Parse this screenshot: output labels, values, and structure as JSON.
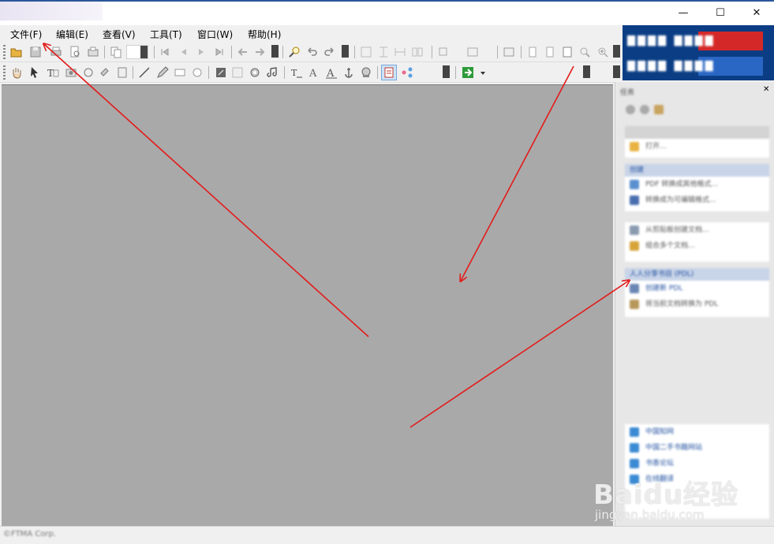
{
  "window": {
    "buttons": {
      "minimize": "—",
      "maximize": "☐",
      "close": "✕"
    }
  },
  "menubar": {
    "items": [
      {
        "label": "文件(F)"
      },
      {
        "label": "编辑(E)"
      },
      {
        "label": "查看(V)"
      },
      {
        "label": "工具(T)"
      },
      {
        "label": "窗口(W)"
      },
      {
        "label": "帮助(H)"
      }
    ]
  },
  "toolbar1": {
    "icons": [
      "open-folder-icon",
      "save-icon",
      "print-icon",
      "print-preview-icon",
      "scan-icon",
      "copy-icon",
      "first-page-icon",
      "prev-page-icon",
      "next-page-icon",
      "last-page-icon",
      "back-icon",
      "forward-icon",
      "find-icon",
      "undo-icon",
      "redo-icon",
      "select-area-icon",
      "fit-height-icon",
      "fit-width-icon",
      "columns-icon",
      "rotate-icon",
      "layout-icon",
      "fullscreen-icon",
      "single-page-icon",
      "continuous-page-icon",
      "facing-page-icon",
      "zoom-out-icon",
      "zoom-in-icon"
    ]
  },
  "toolbar2": {
    "icons": [
      "hand-tool-icon",
      "select-arrow-icon",
      "text-select-icon",
      "snapshot-icon",
      "rotate-tool-icon",
      "link-tool-icon",
      "line-tool-icon",
      "pencil-tool-icon",
      "rectangle-tool-icon",
      "ellipse-tool-icon",
      "note-icon",
      "stamp-icon",
      "attach-icon",
      "sound-icon",
      "typewriter-icon",
      "text-style-icon",
      "font-icon",
      "anchor-icon",
      "signature-icon",
      "properties-icon",
      "share-icon",
      "go-icon"
    ]
  },
  "taskpane": {
    "title": "任务",
    "groups": [
      {
        "header": "",
        "items": [
          "打开..."
        ]
      },
      {
        "header": "创建",
        "items": [
          "PDF 转换成其他格式...",
          "转换成为可编辑格式..."
        ]
      },
      {
        "header": "",
        "items": [
          "从剪贴板创建文档...",
          "组合多个文档..."
        ]
      },
      {
        "header": "人人分享书目 (PDL)",
        "items": [
          "创建新 PDL",
          "将当前文档转换为 PDL"
        ]
      }
    ],
    "links": [
      "中国知网",
      "中国二手书籍网站",
      "书香论坛",
      "在线翻译"
    ]
  },
  "statusbar": {
    "text": "©FTMA Corp."
  },
  "watermark": {
    "logo": "Baidu经验",
    "url": "jingyan.baidu.com"
  },
  "colors": {
    "accent": "#0b3d84",
    "workspace": "#a9a9a9",
    "arrow": "#e31b1b"
  }
}
